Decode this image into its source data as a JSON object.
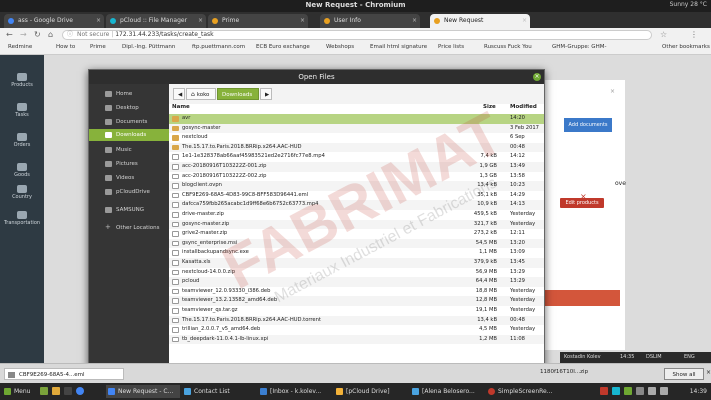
{
  "window": {
    "title": "New Request - Chromium",
    "status": "Sunny 28 °C"
  },
  "tabs": [
    {
      "label": "ass - Google Drive",
      "color": "#4285f4",
      "active": false
    },
    {
      "label": "pCloud :: File Manager",
      "color": "#17b6d0",
      "active": false
    },
    {
      "label": "Prime",
      "color": "#e8a020",
      "active": false
    },
    {
      "label": "User Info",
      "color": "#e8a020",
      "active": false
    },
    {
      "label": "New Request",
      "color": "#e8a020",
      "active": true
    }
  ],
  "address": {
    "security": "Not secure",
    "url": "172.31.44.233/tasks/create_task"
  },
  "bookmarks": [
    "Redmine",
    "How to",
    "Prime",
    "Dipl.-Ing. Püttmann",
    "ftp.puettmann.com",
    "ECB Euro exchange",
    "Webshops",
    "Email html signature",
    "Price lists",
    "Ruscuss Fuck You",
    "GHM-Gruppe: GHM-",
    "Other bookmarks"
  ],
  "leftnav": [
    "Products",
    "Tasks",
    "Orders",
    "Goods",
    "Country",
    "Transportation"
  ],
  "page": {
    "add_documents": "Add documents",
    "edit_products": "Edit products",
    "heading": "De",
    "move": "ove"
  },
  "dialog": {
    "title": "Open Files",
    "close": "×",
    "sidebar": [
      "Home",
      "Desktop",
      "Documents",
      "Downloads",
      "Music",
      "Pictures",
      "Videos",
      "pCloudDrive",
      "SAMSUNG",
      "Other Locations"
    ],
    "sidebar_active": "Downloads",
    "path": {
      "back": "◀",
      "home": "koko",
      "current": "Downloads",
      "forward": "▶"
    },
    "columns": {
      "name": "Name",
      "size": "Size",
      "modified": "Modified"
    },
    "files": [
      {
        "name": "avr",
        "size": "",
        "modified": "14:20",
        "type": "folder",
        "selected": true
      },
      {
        "name": "gosync-master",
        "size": "",
        "modified": "3 Feb 2017",
        "type": "folder"
      },
      {
        "name": "nextcloud",
        "size": "",
        "modified": "6 Sep",
        "type": "folder"
      },
      {
        "name": "The.15.17.to.Paris.2018.BRRip.x264.AAC-HUD",
        "size": "",
        "modified": "00:48",
        "type": "folder"
      },
      {
        "name": "1e1-1e328378ab66aaf45983521ed2e2716fc77e8.mp4",
        "size": "7,4 kB",
        "modified": "14:12",
        "type": "file"
      },
      {
        "name": "acc-20180916T103222Z-001.zip",
        "size": "1,9 GB",
        "modified": "13:49",
        "type": "file"
      },
      {
        "name": "acc-20180916T103222Z-002.zip",
        "size": "1,3 GB",
        "modified": "13:58",
        "type": "file"
      },
      {
        "name": "blogclient.ovpn",
        "size": "13,4 kB",
        "modified": "10:23",
        "type": "file"
      },
      {
        "name": "CBF9E269-68A5-4D83-99C8-BFF583D96441.eml",
        "size": "35,1 kB",
        "modified": "14:29",
        "type": "file"
      },
      {
        "name": "dafcca759fbb265acabc1d9ff68e6b6752c63773.mp4",
        "size": "10,9 kB",
        "modified": "14:13",
        "type": "file"
      },
      {
        "name": "drive-master.zip",
        "size": "459,5 kB",
        "modified": "Yesterday",
        "type": "file"
      },
      {
        "name": "gosync-master.zip",
        "size": "321,7 kB",
        "modified": "Yesterday",
        "type": "file"
      },
      {
        "name": "grive2-master.zip",
        "size": "273,2 kB",
        "modified": "12:11",
        "type": "file"
      },
      {
        "name": "gsync_enterprise.msi",
        "size": "54,5 MB",
        "modified": "13:20",
        "type": "file"
      },
      {
        "name": "installbackupandsync.exe",
        "size": "1,1 MB",
        "modified": "13:09",
        "type": "file"
      },
      {
        "name": "Kasatta.xls",
        "size": "379,9 kB",
        "modified": "13:45",
        "type": "file"
      },
      {
        "name": "nextcloud-14.0.0.zip",
        "size": "56,9 MB",
        "modified": "13:29",
        "type": "file"
      },
      {
        "name": "pcloud",
        "size": "64,4 MB",
        "modified": "13:29",
        "type": "file"
      },
      {
        "name": "teamviewer_12.0.93330_i386.deb",
        "size": "18,8 MB",
        "modified": "Yesterday",
        "type": "file"
      },
      {
        "name": "teamviewer_13.2.13582_amd64.deb",
        "size": "12,8 MB",
        "modified": "Yesterday",
        "type": "file"
      },
      {
        "name": "teamviewer_qs.tar.gz",
        "size": "19,1 MB",
        "modified": "Yesterday",
        "type": "file"
      },
      {
        "name": "The.15.17.to.Paris.2018.BRRip.x264.AAC-HUD.torrent",
        "size": "13,4 kB",
        "modified": "00:48",
        "type": "file"
      },
      {
        "name": "trillian_2.0.0.7_v5_amd64.deb",
        "size": "4,5 MB",
        "modified": "Yesterday",
        "type": "file"
      },
      {
        "name": "tb_deepdark-11.0.4.1-lb-linux.xpi",
        "size": "1,2 MB",
        "modified": "11:08",
        "type": "file"
      }
    ]
  },
  "winbar": {
    "user": "Kostadin Kolev",
    "time": "14:35",
    "kb": "DSLIM",
    "lang": "ENG"
  },
  "downloads": {
    "item": "CBF9E269-68A5-4...eml",
    "show_all": "Show all",
    "extra": "1180f16T10I...zip"
  },
  "taskbar": {
    "items": [
      {
        "label": "Menu",
        "color": "#6fa832"
      },
      {
        "label": "New Request - C...",
        "color": "#4285f4",
        "active": true
      },
      {
        "label": "Contact List",
        "color": "#4aa3df"
      },
      {
        "label": "[Inbox - k.kolev...",
        "color": "#3b7fd1"
      },
      {
        "label": "[pCloud Drive]",
        "color": "#f3b239"
      },
      {
        "label": "[Alena Belosero...",
        "color": "#4aa3df"
      },
      {
        "label": "SimpleScreenRe...",
        "color": "#c0392b"
      }
    ],
    "clock": "14:39"
  },
  "watermark": {
    "brand": "FABRIMAT",
    "tagline": "Materiaux Industriel et Fabrications"
  }
}
